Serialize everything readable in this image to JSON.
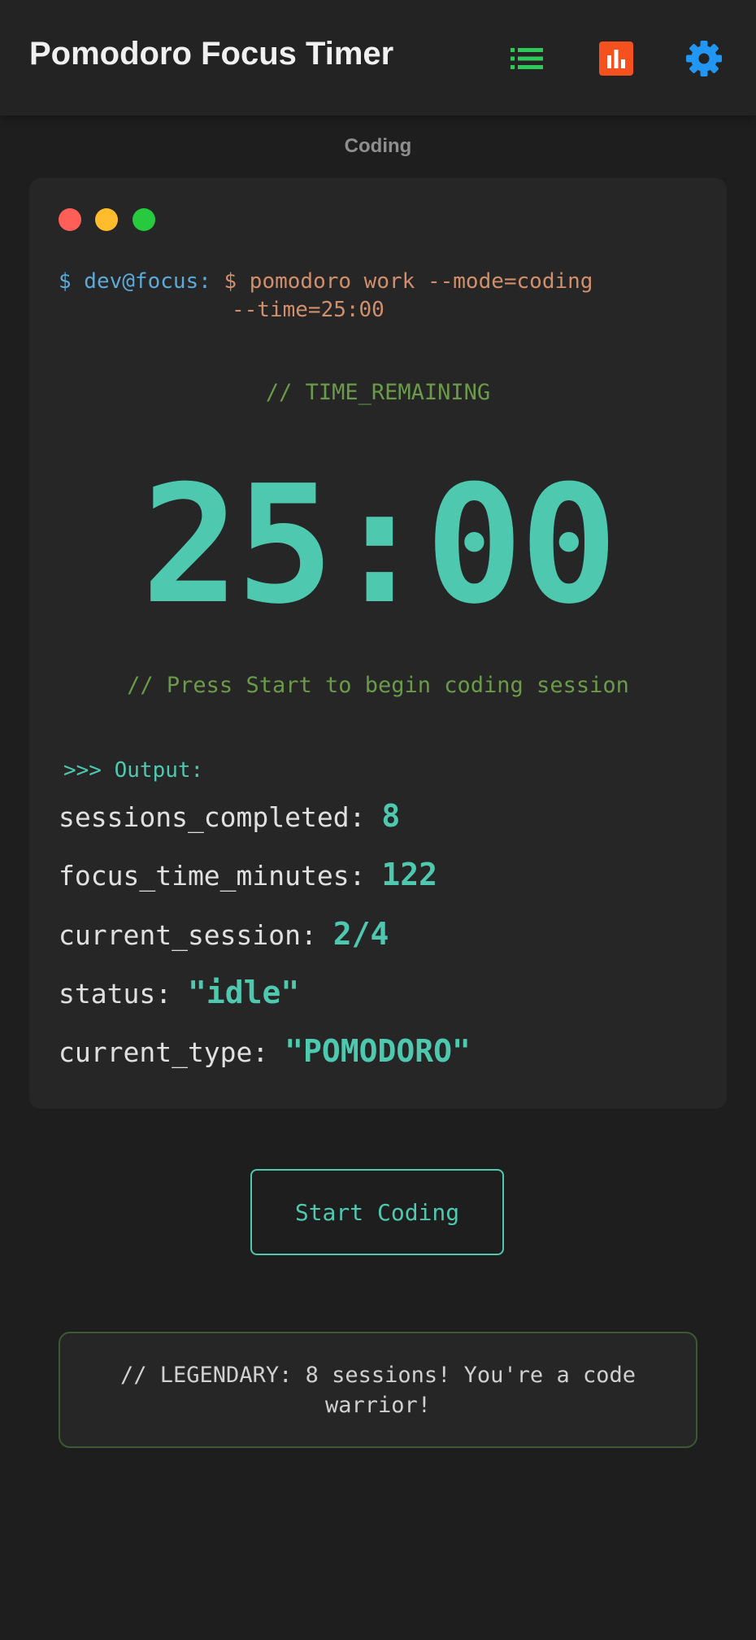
{
  "app": {
    "title": "Pomodoro Focus Timer",
    "icons": [
      "list-icon",
      "bar-chart-icon",
      "gear-icon"
    ],
    "colors": {
      "list_icon": "#2ec95a",
      "chart_icon": "#f4511e",
      "gear_icon": "#2196f3"
    }
  },
  "mode": {
    "label": "Coding"
  },
  "terminal": {
    "window_dots": [
      "#ff5f56",
      "#ffbd2e",
      "#27c93f"
    ],
    "prompt_user": "$ dev@focus:",
    "prompt_cmd": "$ pomodoro work --mode=coding",
    "prompt_cmd_wrap": "--time=25:00",
    "time_comment": "// TIME_REMAINING",
    "time_display": "25:00",
    "hint_comment": "// Press Start to begin coding session",
    "output_header": ">>> Output:",
    "stats": [
      {
        "key": "sessions_completed:",
        "value": "8"
      },
      {
        "key": "focus_time_minutes:",
        "value": "122"
      },
      {
        "key": "current_session:",
        "value": "2/4"
      },
      {
        "key": "status:",
        "value": "\"idle\""
      },
      {
        "key": "current_type:",
        "value": "\"POMODORO\""
      }
    ]
  },
  "actions": {
    "start_label": "Start Coding"
  },
  "achievement": {
    "text": "// LEGENDARY: 8 sessions! You're a code warrior!"
  }
}
